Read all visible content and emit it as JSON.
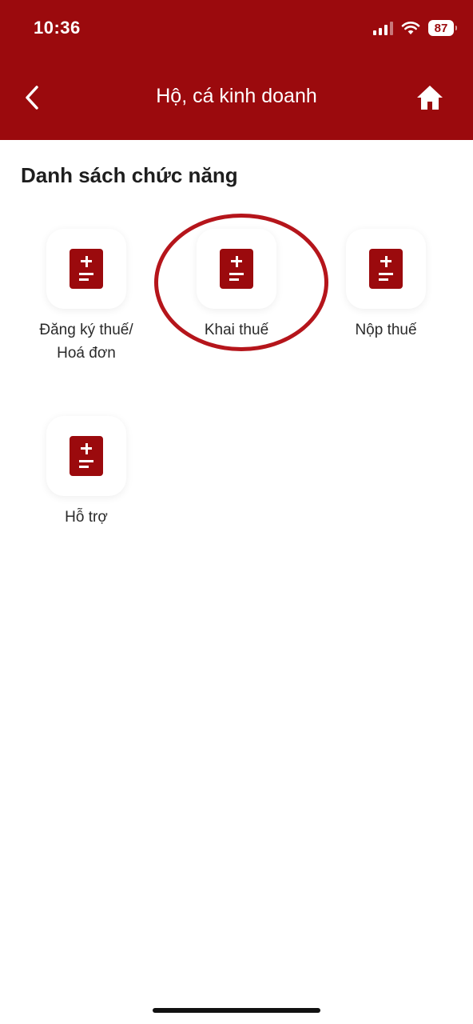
{
  "status_bar": {
    "time": "10:36",
    "battery": "87",
    "icons": [
      "cellular-signal-icon",
      "wifi-icon",
      "battery-icon"
    ]
  },
  "header": {
    "title": "Hộ, cá kinh doanh",
    "back_icon": "chevron-left-icon",
    "home_icon": "home-icon",
    "background_color": "#9b0a0d"
  },
  "section": {
    "title": "Danh sách chức năng"
  },
  "functions": [
    {
      "label_line1": "Đăng ký thuế/",
      "label_line2": "Hoá đơn",
      "icon": "calculator-icon"
    },
    {
      "label_line1": "Khai thuế",
      "label_line2": "",
      "icon": "calculator-icon",
      "highlighted": true
    },
    {
      "label_line1": "Nộp thuế",
      "label_line2": "",
      "icon": "calculator-icon"
    },
    {
      "label_line1": "Hỗ trợ",
      "label_line2": "",
      "icon": "calculator-icon"
    }
  ],
  "colors": {
    "accent": "#9b0a0d",
    "annotation": "#b5151b",
    "text": "#2a2a2a"
  }
}
